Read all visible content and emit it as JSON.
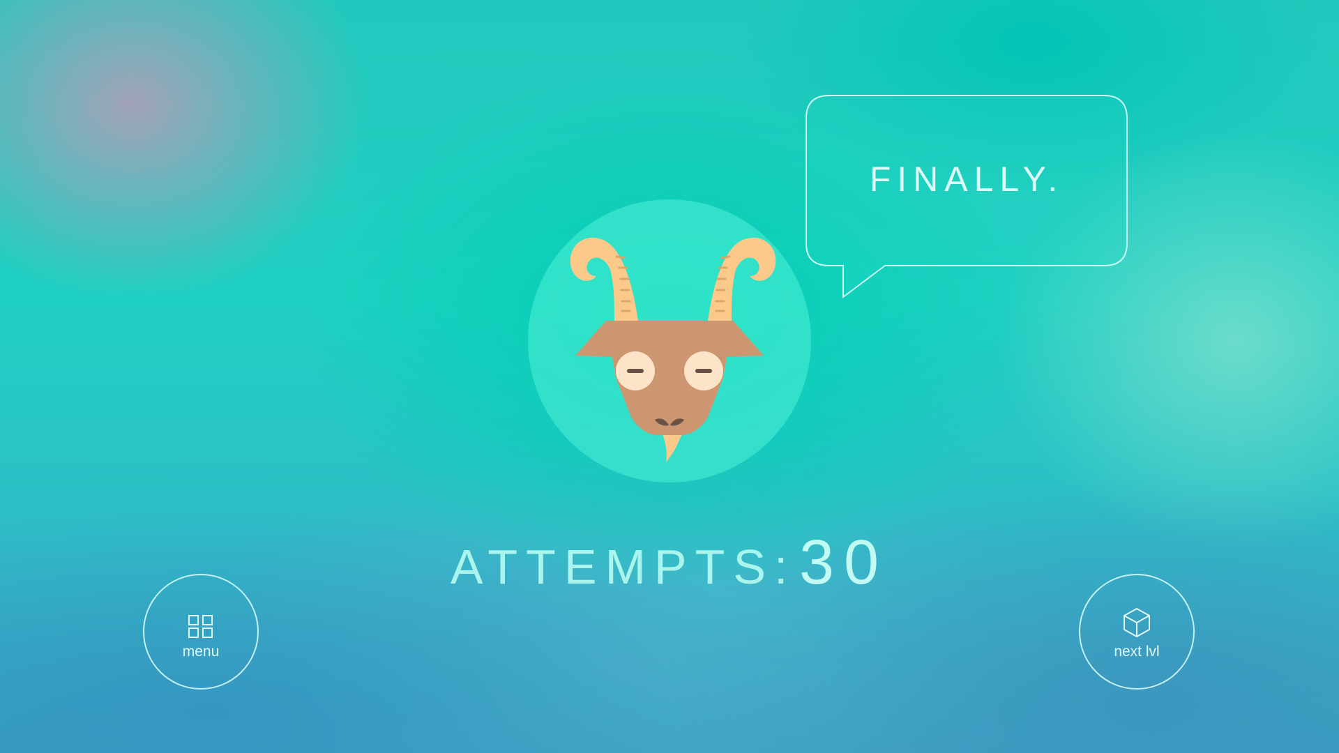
{
  "dialog": {
    "speech_text": "FINALLY."
  },
  "result": {
    "attempts_label": "ATTEMPTS:",
    "attempts_value": "30"
  },
  "buttons": {
    "menu": {
      "label": "menu",
      "icon": "grid-icon"
    },
    "next": {
      "label": "next lvl",
      "icon": "cube-icon"
    }
  },
  "character": {
    "name_icon": "goat-icon",
    "colors": {
      "circle": "#45e8cf",
      "horn": "#fbc98a",
      "face": "#cc9670",
      "eyes": "#fde3c8",
      "beard": "#fbc98a"
    }
  }
}
